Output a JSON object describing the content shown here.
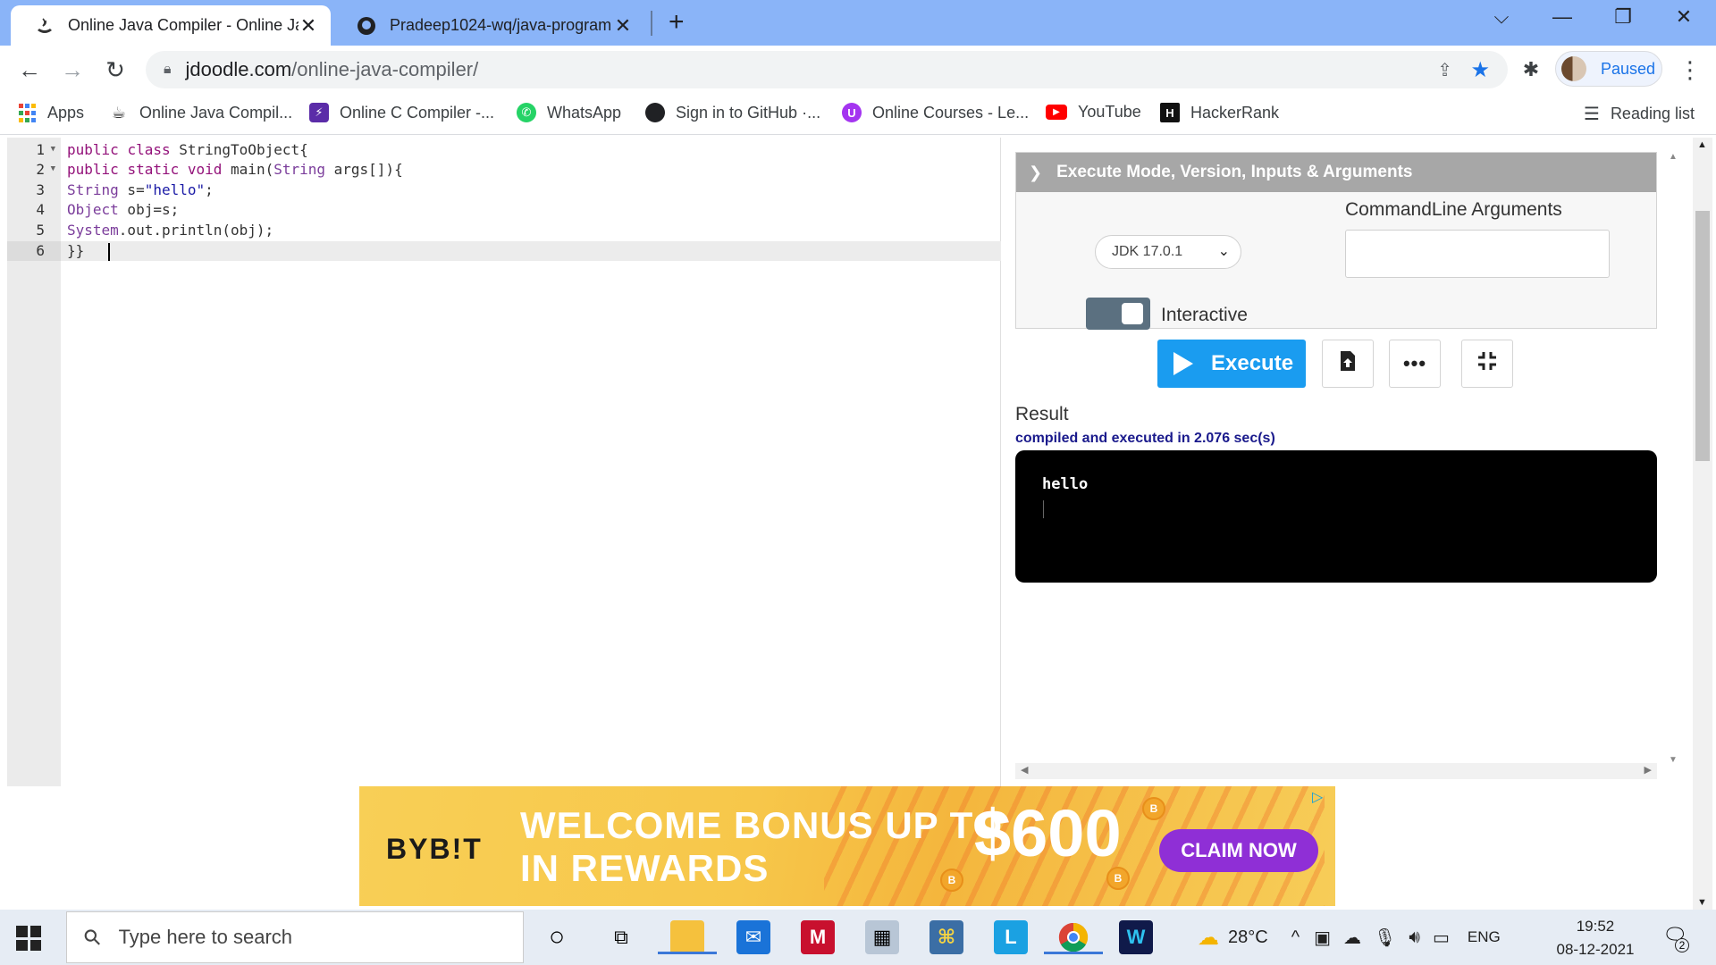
{
  "browser": {
    "tabs": [
      {
        "title": "Online Java Compiler - Online Ja",
        "active": true
      },
      {
        "title": "Pradeep1024-wq/java-program",
        "active": false
      }
    ],
    "url_host": "jdoodle.com",
    "url_path": "/online-java-compiler/",
    "profile_label": "Paused",
    "bookmarks": [
      {
        "label": "Apps",
        "icon": "apps-grid-icon"
      },
      {
        "label": "Online Java Compil...",
        "icon": "java-icon"
      },
      {
        "label": "Online C Compiler -...",
        "icon": "c-compiler-icon"
      },
      {
        "label": "WhatsApp",
        "icon": "whatsapp-icon"
      },
      {
        "label": "Sign in to GitHub ·...",
        "icon": "github-icon"
      },
      {
        "label": "Online Courses - Le...",
        "icon": "udemy-icon"
      },
      {
        "label": "YouTube",
        "icon": "youtube-icon"
      },
      {
        "label": "HackerRank",
        "icon": "hackerrank-icon"
      }
    ],
    "reading_list": "Reading list"
  },
  "editor": {
    "lines": [
      "1",
      "2",
      "3",
      "4",
      "5",
      "6"
    ]
  },
  "panel": {
    "settings_title": "Execute Mode, Version, Inputs & Arguments",
    "jdk_version": "JDK 17.0.1",
    "cmd_args_label": "CommandLine Arguments",
    "cmd_args_value": "",
    "interactive_label": "Interactive",
    "execute_label": "Execute",
    "result_label": "Result",
    "result_status": "compiled and executed in 2.076 sec(s)",
    "output": "hello"
  },
  "ad": {
    "logo": "BYB!T",
    "headline_1": "WELCOME BONUS UP TO",
    "headline_2": "IN REWARDS",
    "amount": "$600",
    "cta": "CLAIM NOW"
  },
  "taskbar": {
    "search_placeholder": "Type here to search",
    "temperature": "28°C",
    "language": "ENG",
    "time": "19:52",
    "date": "08-12-2021",
    "notifications": "2"
  },
  "colors": {
    "tabbar": "#8ab4f8",
    "execute_button": "#1a9cf0",
    "result_status": "#1a1a8c",
    "ad_cta": "#8f2fd6"
  }
}
